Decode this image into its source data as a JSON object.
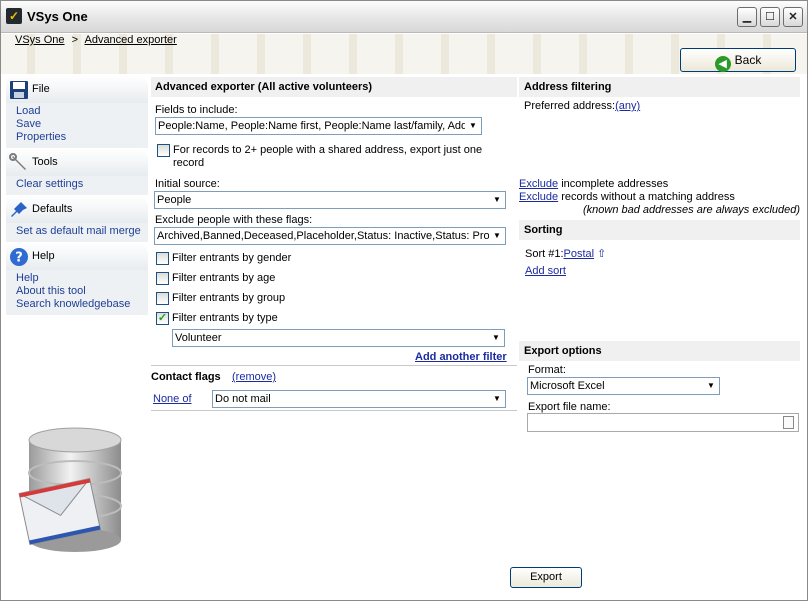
{
  "window": {
    "title": "VSys One"
  },
  "breadcrumb": [
    "VSys One",
    "Advanced exporter"
  ],
  "breadcrumb_sep": ">",
  "back_label": "Back",
  "sidebar": {
    "sections": [
      {
        "title": "File",
        "icon": "floppy-disk-icon",
        "links": [
          "Load",
          "Save",
          "Properties"
        ]
      },
      {
        "title": "Tools",
        "icon": "wrench-icon",
        "links": [
          "Clear settings"
        ]
      },
      {
        "title": "Defaults",
        "icon": "pushpin-icon",
        "links": [
          "Set as default mail merge"
        ]
      },
      {
        "title": "Help",
        "icon": "help-icon",
        "links": [
          "Help",
          "About this tool",
          "Search knowledgebase"
        ]
      }
    ]
  },
  "exporter": {
    "title": "Advanced exporter (All active volunteers)",
    "fields_label": "Fields to include:",
    "fields_value": "People:Name, People:Name first, People:Name last/family, Addr",
    "shared_address_text": "For records to 2+ people with a shared address, export just one record",
    "initial_source_label": "Initial source:",
    "initial_source_value": "People",
    "exclude_flags_label": "Exclude people with these flags:",
    "exclude_flags_value": "Archived,Banned,Deceased,Placeholder,Status: Inactive,Status: Pro",
    "filters": [
      {
        "label": "Filter entrants by gender",
        "checked": false
      },
      {
        "label": "Filter entrants by age",
        "checked": false
      },
      {
        "label": "Filter entrants by group",
        "checked": false
      },
      {
        "label": "Filter entrants by type",
        "checked": true
      }
    ],
    "type_value": "Volunteer",
    "add_filter": "Add another filter"
  },
  "contact_flags": {
    "title": "Contact flags",
    "remove": "(remove)",
    "mode": "None of",
    "value": "Do not mail"
  },
  "address_filtering": {
    "title": "Address filtering",
    "preferred_label": "Preferred address:",
    "preferred_value": "(any)",
    "exclude_word": "Exclude",
    "exclude1_rest": " incomplete addresses",
    "exclude2_rest": " records without a matching address",
    "note": "(known bad addresses are always excluded)"
  },
  "sorting": {
    "title": "Sorting",
    "sort1_label": "Sort #1:",
    "sort1_value": "Postal",
    "sort1_arrow": "⇧",
    "add_sort": "Add sort"
  },
  "export_options": {
    "title": "Export options",
    "format_label": "Format:",
    "format_value": "Microsoft Excel",
    "file_label": "Export file name:",
    "file_value": ""
  },
  "export_button": "Export"
}
